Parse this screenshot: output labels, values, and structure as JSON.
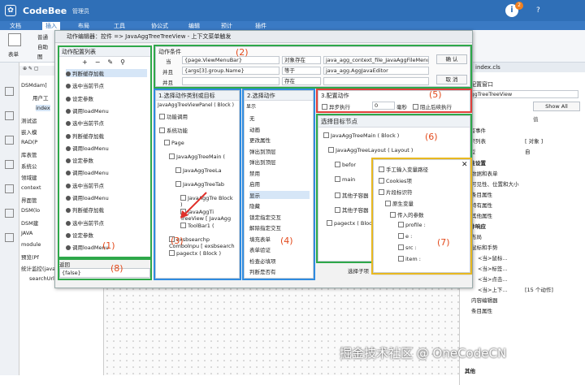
{
  "app": {
    "name": "CodeBee",
    "user": "管理员",
    "notif_count": "2",
    "help": "?"
  },
  "menu": [
    "文档",
    "插入",
    "布局",
    "工具",
    "协公式",
    "编辑",
    "预计",
    "插件"
  ],
  "ribbon": {
    "btn1": "表单",
    "items": [
      "普通",
      "自助",
      "图"
    ]
  },
  "left_tree": [
    "DSMdam]",
    "用户工",
    "index",
    "测试运",
    "嵌入模",
    "RAD(P",
    "库表管",
    "系统公",
    "领域建",
    "context",
    "界面管",
    "DSM(lo",
    "DSM建",
    "JAVA",
    "module",
    "预览(Pf",
    "统计监控(javadb)",
    "searchUrl.ds"
  ],
  "left_tab": "index.cls",
  "dialog": {
    "title": "动作编辑器：控件 => JavaAggTreeTreeView - 上下文菜单触发",
    "action_list_title": "动作配置列表",
    "actions": [
      "判断缓存加载",
      "选中当前节点",
      "设定参数",
      "调用loadMenu",
      "选中当前节点",
      "判断缓存加载",
      "调用loadMenu",
      "设定参数",
      "调用loadMenu",
      "选中当前节点",
      "调用loadMenu",
      "判断缓存加载",
      "选中当前节点",
      "设定参数",
      "调用loadMenu"
    ],
    "cond_title": "动作条件",
    "cond_rows": [
      {
        "label": "当",
        "expr": "{page.ViewMenuBar}",
        "op": "对象存在",
        "value": "java_agg_context_file_JavaAggFileMenu"
      },
      {
        "label": "并且",
        "expr": "{args[3].group.Name}",
        "op": "等于",
        "value": "java_agg.AggJavaEditor"
      },
      {
        "label": "并且",
        "expr": "",
        "op": "存在",
        "value": ""
      }
    ],
    "ok": "确 认",
    "cancel": "取 消",
    "col1_title": "1.选择动作类别或目标",
    "col1_sub": "JavaAggTreeViewPanel ( Block )",
    "col1_items": [
      "功能调用",
      "系统功能",
      "Page",
      "JavaAggTreeMain (",
      "JavaAggTreeLa",
      "JavaAggTreeTab",
      "JavaAggTre Block )",
      "JavaAggTi TreeView [ JavaAgg",
      "ToolBar1 (",
      "exsbsearchp Combolnpu [ exsbsearch",
      "pagectx ( Block )"
    ],
    "col2_title": "2.选择动作",
    "col2_sub": "显示",
    "col2_items": [
      "无",
      "动画",
      "更改属性",
      "弹出到顶层",
      "弹出到顶层",
      "禁用",
      "启用",
      "显示",
      "隐藏",
      "锁定指定交互",
      "解除指定交互",
      "填充表单",
      "表单验证",
      "检查必填项",
      "判断是否有"
    ],
    "col3_title": "3.配置动作",
    "col3_async": "异步执行",
    "col3_ms": "0",
    "col3_ms_unit": "毫秒",
    "col3_stop": "阻止后续执行",
    "col3_target_title": "选择目标节点",
    "col3_tree": [
      "JavaAggTreeMain ( Block )",
      "JavaAggTreeLayout ( Layout )",
      "befor",
      "main",
      "其他子容器",
      "其他子容器",
      "pagectx ( Block"
    ],
    "var_popup": [
      "手工输入变量路径",
      "Cookies项",
      "片段标识符",
      "原生变量",
      "传入的参数",
      "profile :",
      "e :",
      "src :",
      "item :"
    ],
    "bottom_label": "选择子项",
    "status_label": "返回",
    "status_value": "{false}"
  },
  "right_panel": {
    "title": "件配置窗口",
    "combo": "AggTreeTreeView",
    "show_all": "Show All",
    "col_value": "值",
    "items": [
      "特有事件",
      "标识列表",
      "[ 对象 ]",
      "类型",
      "自",
      "属性设置",
      "数据和表单",
      "可见性、位置和大小",
      "条目属性",
      "特有属性",
      "其他属性",
      "事件响应",
      "布局",
      "鼠标和手势",
      "<当>鼠标...",
      "<当>标签...",
      "<当>点击...",
      "<当>上下...",
      "[15 个动作]",
      "内容编辑器",
      "条目属性",
      "其他"
    ]
  },
  "annotations": [
    "(1)",
    "(2)",
    "(3)",
    "(4)",
    "(5)",
    "(6)",
    "(7)",
    "(8)"
  ],
  "watermark": "掘金技术社区 @ OneCodeCN"
}
